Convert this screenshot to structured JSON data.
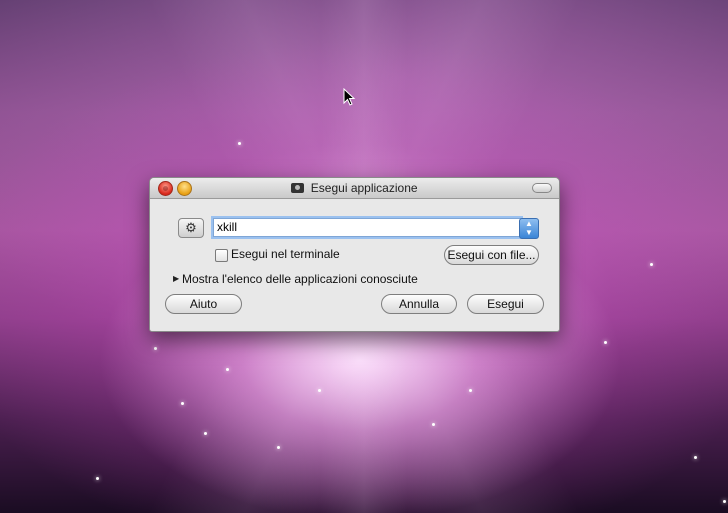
{
  "window": {
    "title": "Esegui applicazione"
  },
  "command": {
    "value": "xkill"
  },
  "options": {
    "run_in_terminal_label": "Esegui nel terminale",
    "run_in_terminal_checked": false,
    "run_with_file_label": "Esegui con file...",
    "show_known_apps_label": "Mostra l'elenco delle applicazioni conosciute"
  },
  "buttons": {
    "help_label": "Aiuto",
    "cancel_label": "Annulla",
    "run_label": "Esegui"
  },
  "colors": {
    "accent": "#3a84d6",
    "close": "#d8281c",
    "minimize": "#e8a014"
  },
  "icons": {
    "gear": "gear-icon",
    "combo_arrows": "updown-arrows-icon",
    "disclosure": "disclosure-triangle-icon",
    "title": "application-icon"
  }
}
